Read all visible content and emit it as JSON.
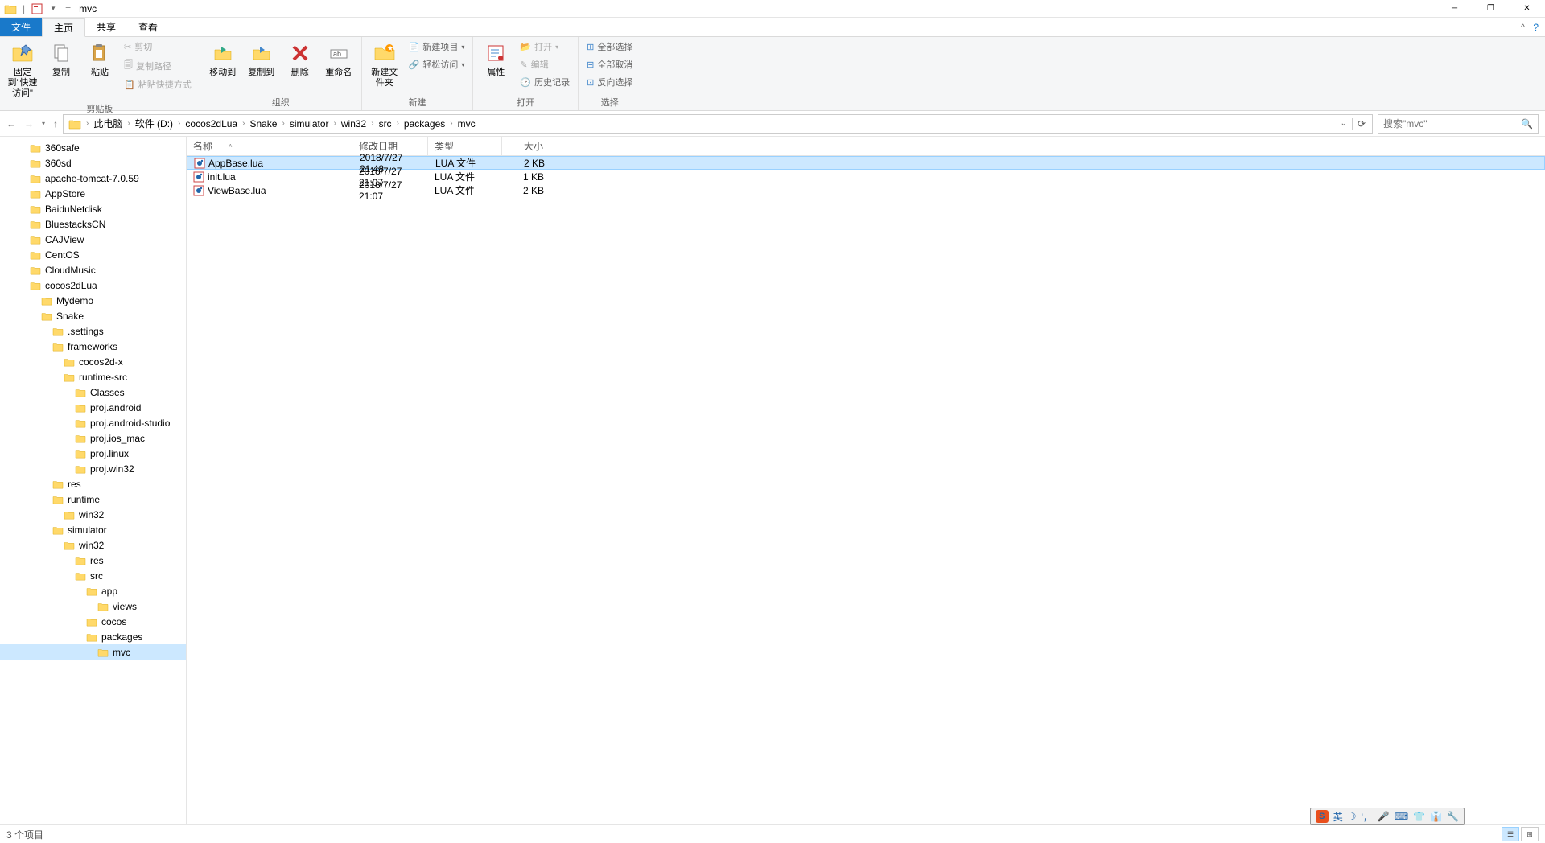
{
  "window": {
    "title": "mvc"
  },
  "tabs": {
    "file": "文件",
    "home": "主页",
    "share": "共享",
    "view": "查看"
  },
  "ribbon": {
    "clipboard": {
      "pin": "固定到\"快速访问\"",
      "copy": "复制",
      "paste": "粘贴",
      "cut": "剪切",
      "copypath": "复制路径",
      "pasteshortcut": "粘贴快捷方式",
      "label": "剪贴板"
    },
    "organize": {
      "moveto": "移动到",
      "copyto": "复制到",
      "delete": "删除",
      "rename": "重命名",
      "label": "组织"
    },
    "new": {
      "newfolder": "新建文件夹",
      "newitem": "新建项目",
      "easyaccess": "轻松访问",
      "label": "新建"
    },
    "open": {
      "properties": "属性",
      "open": "打开",
      "edit": "编辑",
      "history": "历史记录",
      "label": "打开"
    },
    "select": {
      "selectall": "全部选择",
      "selectnone": "全部取消",
      "invert": "反向选择",
      "label": "选择"
    }
  },
  "breadcrumb": [
    "此电脑",
    "软件 (D:)",
    "cocos2dLua",
    "Snake",
    "simulator",
    "win32",
    "src",
    "packages",
    "mvc"
  ],
  "search": {
    "placeholder": "搜索\"mvc\""
  },
  "columns": {
    "name": "名称",
    "date": "修改日期",
    "type": "类型",
    "size": "大小"
  },
  "files": [
    {
      "name": "AppBase.lua",
      "date": "2018/7/27 21:48",
      "type": "LUA 文件",
      "size": "2 KB",
      "selected": true
    },
    {
      "name": "init.lua",
      "date": "2018/7/27 21:07",
      "type": "LUA 文件",
      "size": "1 KB",
      "selected": false
    },
    {
      "name": "ViewBase.lua",
      "date": "2018/7/27 21:07",
      "type": "LUA 文件",
      "size": "2 KB",
      "selected": false
    }
  ],
  "tree": [
    {
      "name": "360safe",
      "depth": 1
    },
    {
      "name": "360sd",
      "depth": 1
    },
    {
      "name": "apache-tomcat-7.0.59",
      "depth": 1
    },
    {
      "name": "AppStore",
      "depth": 1
    },
    {
      "name": "BaiduNetdisk",
      "depth": 1
    },
    {
      "name": "BluestacksCN",
      "depth": 1
    },
    {
      "name": "CAJView",
      "depth": 1
    },
    {
      "name": "CentOS",
      "depth": 1
    },
    {
      "name": "CloudMusic",
      "depth": 1
    },
    {
      "name": "cocos2dLua",
      "depth": 1
    },
    {
      "name": "Mydemo",
      "depth": 2
    },
    {
      "name": "Snake",
      "depth": 2
    },
    {
      "name": ".settings",
      "depth": 3
    },
    {
      "name": "frameworks",
      "depth": 3
    },
    {
      "name": "cocos2d-x",
      "depth": 4
    },
    {
      "name": "runtime-src",
      "depth": 4
    },
    {
      "name": "Classes",
      "depth": 5
    },
    {
      "name": "proj.android",
      "depth": 5
    },
    {
      "name": "proj.android-studio",
      "depth": 5
    },
    {
      "name": "proj.ios_mac",
      "depth": 5
    },
    {
      "name": "proj.linux",
      "depth": 5
    },
    {
      "name": "proj.win32",
      "depth": 5
    },
    {
      "name": "res",
      "depth": 3
    },
    {
      "name": "runtime",
      "depth": 3
    },
    {
      "name": "win32",
      "depth": 4
    },
    {
      "name": "simulator",
      "depth": 3
    },
    {
      "name": "win32",
      "depth": 4
    },
    {
      "name": "res",
      "depth": 5
    },
    {
      "name": "src",
      "depth": 5
    },
    {
      "name": "app",
      "depth": 6
    },
    {
      "name": "views",
      "depth": 7
    },
    {
      "name": "cocos",
      "depth": 6
    },
    {
      "name": "packages",
      "depth": 6
    },
    {
      "name": "mvc",
      "depth": 7,
      "selected": true
    }
  ],
  "status": {
    "items": "3 个项目"
  },
  "tray": {
    "s": "S",
    "ime": "英"
  }
}
